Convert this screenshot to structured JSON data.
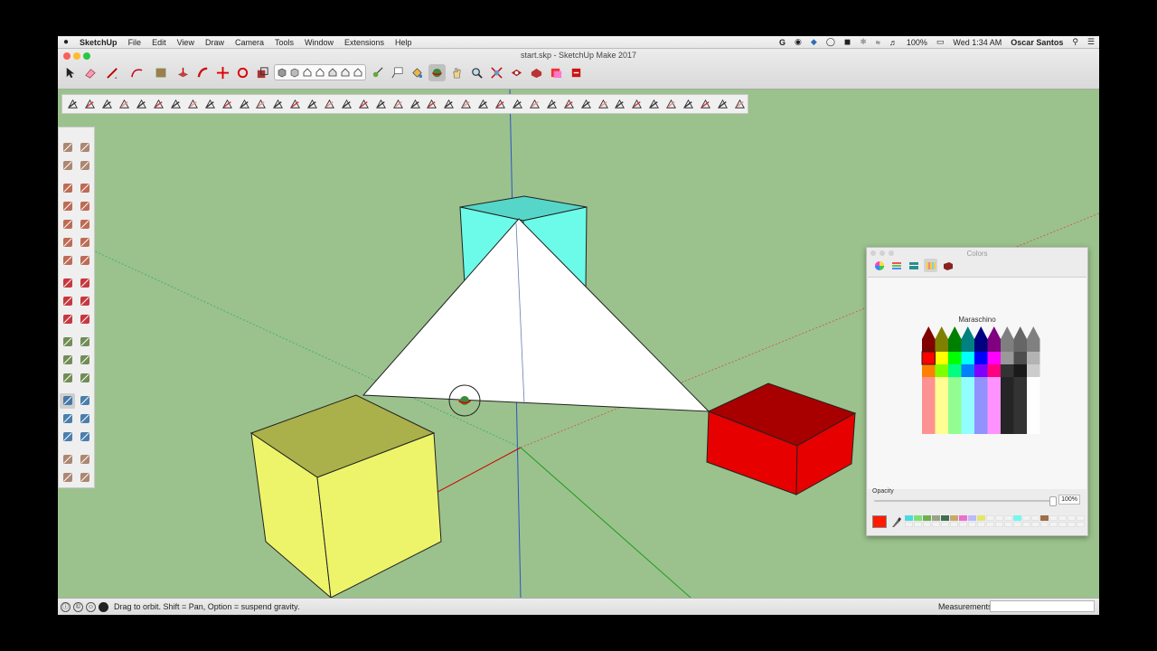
{
  "menubar": {
    "apple": "",
    "app_name": "SketchUp",
    "items": [
      "File",
      "Edit",
      "View",
      "Draw",
      "Camera",
      "Tools",
      "Window",
      "Extensions",
      "Help"
    ],
    "battery": "100%",
    "clock": "Wed 1:34 AM",
    "user": "Oscar Santos"
  },
  "window": {
    "title": "start.skp - SketchUp Make 2017"
  },
  "main_toolbar": {
    "tools": [
      "select",
      "eraser",
      "line",
      "arc",
      "shape",
      "push-pull",
      "follow-me",
      "move",
      "rotate",
      "scale",
      "styles",
      "tape-measure",
      "text",
      "paint-bucket",
      "orbit",
      "pan",
      "zoom",
      "zoom-extents",
      "warehouse",
      "extension-warehouse",
      "send-to-layout",
      "extension-manager"
    ],
    "active_tool": "orbit"
  },
  "colors_panel": {
    "title": "Colors",
    "selected_color_name": "Maraschino",
    "current_color": "#ff1a00",
    "opacity_label": "Opacity",
    "opacity_value": "100%",
    "opacity_level": 1.0,
    "recent_swatches": [
      "#4fd7e0",
      "#7be07a",
      "#6fb04e",
      "#9aa28a",
      "#3e6f4e",
      "#c8a86b",
      "#ec6fc9",
      "#b9b9ff",
      "#e3e56c",
      "",
      "",
      "",
      "#73f7ee",
      "",
      "",
      "#9b6f48"
    ]
  },
  "scene": {
    "colors": {
      "background": "#9bc28c",
      "cyan_box": "#6cfbe8",
      "yellow_box": "#eef46a",
      "red_box": "#e60000",
      "triangle": "#ffffff"
    }
  },
  "statusbar": {
    "message": "Drag to orbit. Shift = Pan, Option = suspend gravity.",
    "measurements_label": "Measurements",
    "measurements_value": ""
  }
}
